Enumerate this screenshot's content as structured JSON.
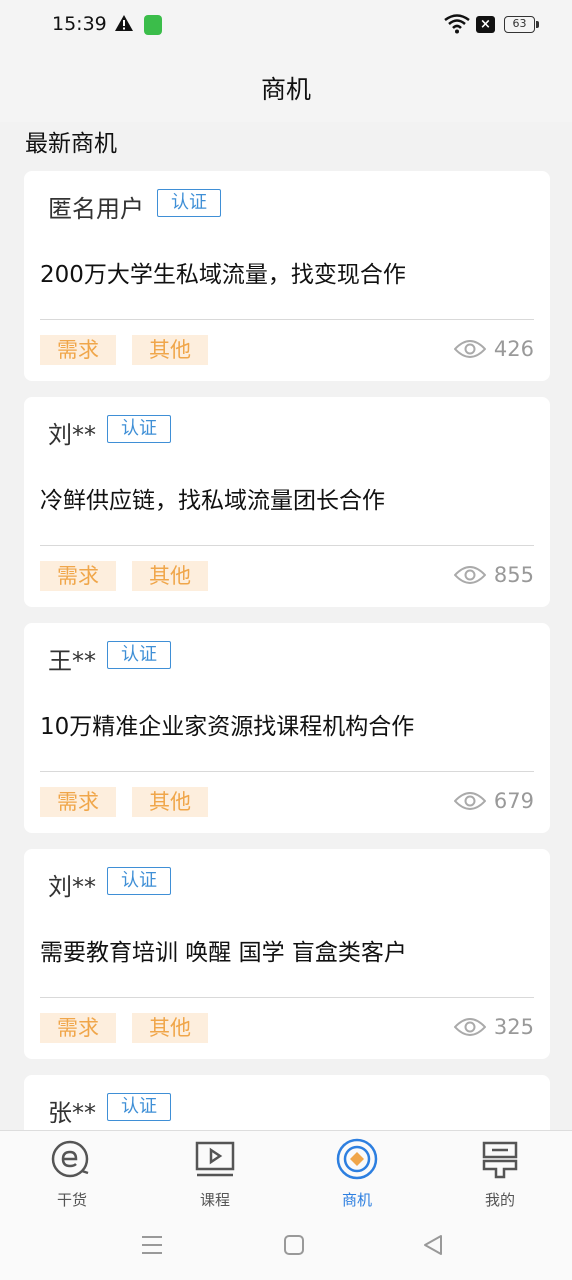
{
  "status": {
    "time": "15:39",
    "battery": "63"
  },
  "header": {
    "title": "商机"
  },
  "section": {
    "title": "最新商机"
  },
  "cards": [
    {
      "user": "匿名用户",
      "badge": "认证",
      "text": "200万大学生私域流量，找变现合作",
      "tags": [
        "需求",
        "其他"
      ],
      "views": "426"
    },
    {
      "user": "刘**",
      "badge": "认证",
      "text": "冷鲜供应链，找私域流量团长合作",
      "tags": [
        "需求",
        "其他"
      ],
      "views": "855"
    },
    {
      "user": "王**",
      "badge": "认证",
      "text": "10万精准企业家资源找课程机构合作",
      "tags": [
        "需求",
        "其他"
      ],
      "views": "679"
    },
    {
      "user": "刘**",
      "badge": "认证",
      "text": "需要教育培训 唤醒 国学 盲盒类客户",
      "tags": [
        "需求",
        "其他"
      ],
      "views": "325"
    },
    {
      "user": "张**",
      "badge": "认证"
    }
  ],
  "tabs": [
    {
      "label": "干货",
      "icon": "e-dry-goods-icon"
    },
    {
      "label": "课程",
      "icon": "video-course-icon"
    },
    {
      "label": "商机",
      "icon": "business-opportunity-icon",
      "active": true
    },
    {
      "label": "我的",
      "icon": "profile-icon"
    }
  ],
  "colors": {
    "accent": "#2d7fe0",
    "badge": "#3f8fd6",
    "tag_bg": "#fdeedd",
    "tag_text": "#f0a64a"
  }
}
